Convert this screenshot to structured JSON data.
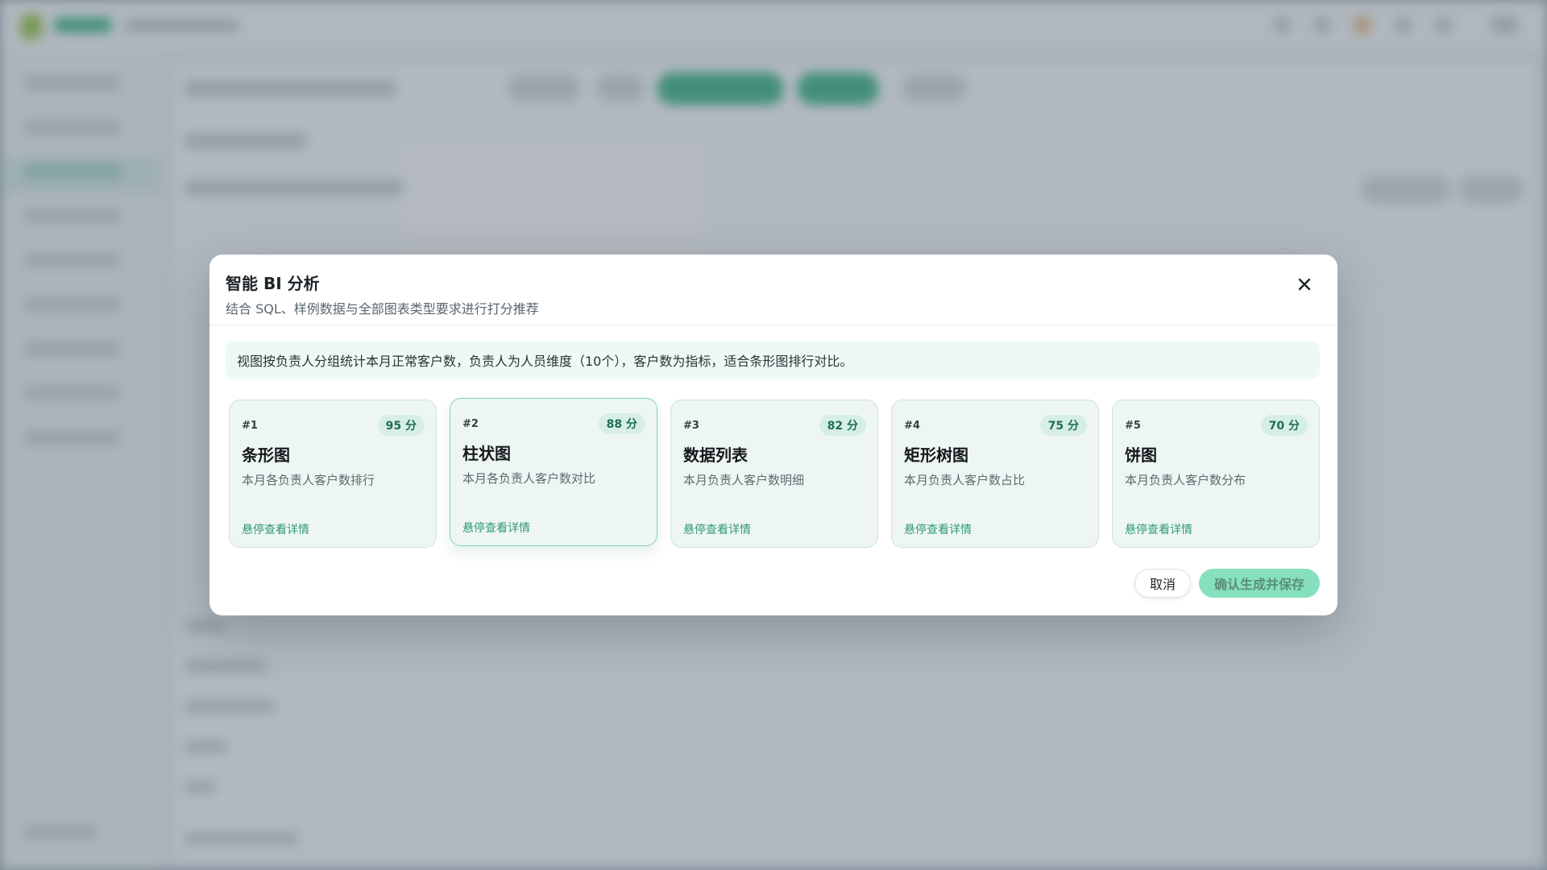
{
  "modal": {
    "title": "智能 BI 分析",
    "subtitle": "结合 SQL、样例数据与全部图表类型要求进行打分推荐",
    "close_icon": "close-icon",
    "summary": "视图按负责人分组统计本月正常客户数，负责人为人员维度（10个），客户数为指标，适合条形图排行对比。",
    "cards": [
      {
        "rank": "#1",
        "score": "95 分",
        "name": "条形图",
        "desc": "本月各负责人客户数排行",
        "link": "悬停查看详情"
      },
      {
        "rank": "#2",
        "score": "88 分",
        "name": "柱状图",
        "desc": "本月各负责人客户数对比",
        "link": "悬停查看详情"
      },
      {
        "rank": "#3",
        "score": "82 分",
        "name": "数据列表",
        "desc": "本月负责人客户数明细",
        "link": "悬停查看详情"
      },
      {
        "rank": "#4",
        "score": "75 分",
        "name": "矩形树图",
        "desc": "本月负责人客户数占比",
        "link": "悬停查看详情"
      },
      {
        "rank": "#5",
        "score": "70 分",
        "name": "饼图",
        "desc": "本月负责人客户数分布",
        "link": "悬停查看详情"
      }
    ],
    "cancel_label": "取消",
    "confirm_label": "确认生成并保存"
  },
  "colors": {
    "accent": "#2fae7d",
    "confirm_bg": "#86e0bd",
    "card_bg": "#eef6f4",
    "summary_bg": "#eef9f5"
  }
}
